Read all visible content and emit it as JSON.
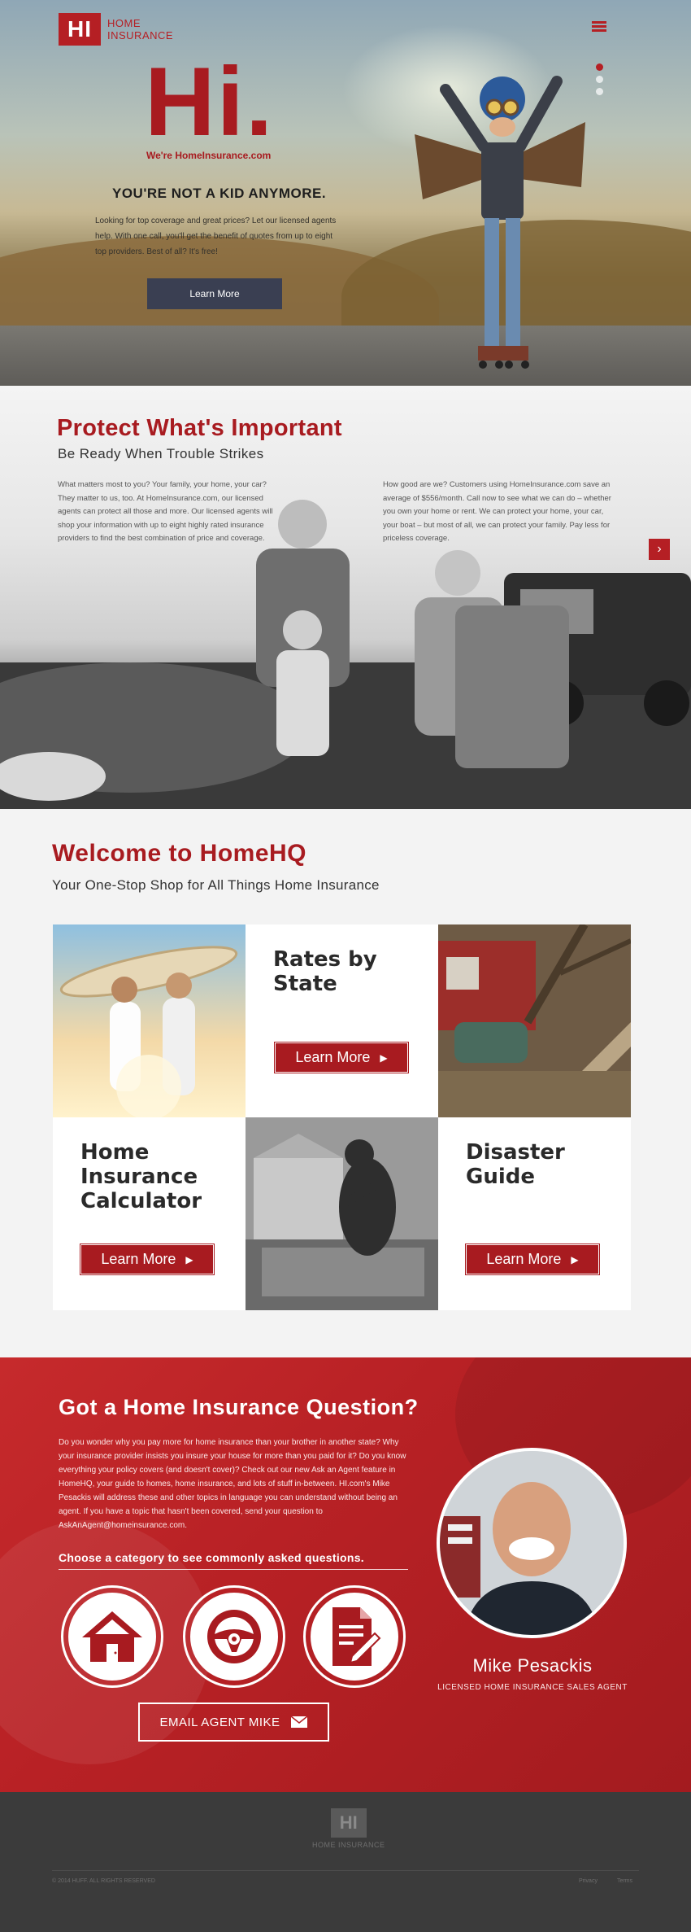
{
  "header": {
    "logo_mark": "HI",
    "logo_line1": "HOME",
    "logo_line2": "INSURANCE"
  },
  "hero": {
    "greeting": "Hi.",
    "tagline": "We're HomeInsurance.com",
    "headline": "YOU'RE NOT A KID ANYMORE.",
    "body": "Looking for top coverage and great prices? Let our licensed agents help. With one call, you'll get the benefit of quotes from up to eight top providers. Best of all? It's free!",
    "button_label": "Learn More",
    "slides": 3,
    "active_slide": 1
  },
  "protect": {
    "title": "Protect What's Important",
    "subtitle": "Be Ready When Trouble Strikes",
    "col1": "What matters most to you? Your family, your home, your car? They matter to us, too. At HomeInsurance.com, our licensed agents can protect all those and more. Our licensed agents will shop your information with up to eight highly rated insurance providers to find the best combination of price and coverage.",
    "col2": "How good are we? Customers using HomeInsurance.com save an average of $556/month. Call now to see what we can do – whether you own your home or rent. We can protect your home, your car, your boat – but most of all, we can protect your family. Pay less for priceless coverage.",
    "next_label": "›"
  },
  "welcome": {
    "title": "Welcome to HomeHQ",
    "subtitle": "Your One-Stop Shop for All Things Home Insurance",
    "cards": [
      {
        "title": "Rates by State",
        "button": "Learn More"
      },
      {
        "title": "Home Insurance Calculator",
        "button": "Learn More"
      },
      {
        "title": "Disaster Guide",
        "button": "Learn More"
      }
    ]
  },
  "question": {
    "title": "Got a Home Insurance Question?",
    "body": "Do you wonder why you pay more for home insurance than your brother in another state? Why your insurance provider insists you insure your house for more than you paid for it? Do you know everything your policy covers (and doesn't cover)? Check out our new Ask an Agent feature in HomeHQ, your guide to homes, home insurance, and lots of stuff in-between. HI.com's Mike Pesackis will address these and other topics in language you can understand without being an agent. If you have a topic that hasn't been covered, send your question to AskAnAgent@homeinsurance.com.",
    "category_prompt": "Choose a category to see commonly asked questions.",
    "categories": [
      "house-icon",
      "steering-wheel-icon",
      "document-pen-icon"
    ],
    "agent_name": "Mike Pesackis",
    "agent_title": "LICENSED HOME INSURANCE SALES AGENT",
    "email_button": "EMAIL AGENT MIKE"
  },
  "footer": {
    "logo_mark": "HI",
    "logo_text": "HOME INSURANCE",
    "copyright": "© 2014 HUFF. ALL RIGHTS RESERVED",
    "links": [
      "Privacy",
      "Terms"
    ]
  },
  "colors": {
    "brand_red": "#b51f24",
    "dark_slate": "#3a3f52",
    "footer": "#3b3b3b"
  }
}
